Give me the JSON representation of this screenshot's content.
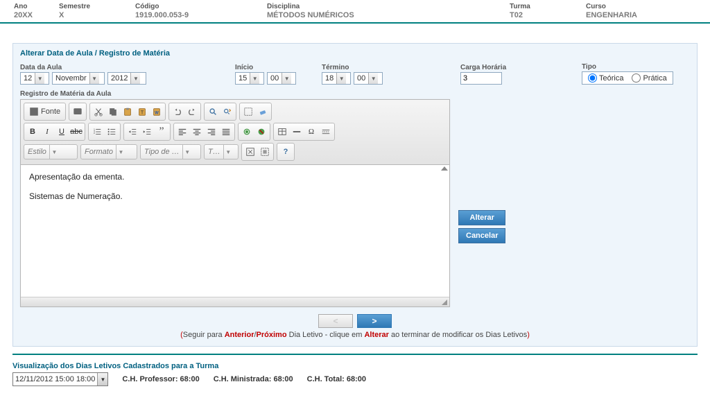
{
  "header": {
    "labels": {
      "ano": "Ano",
      "semestre": "Semestre",
      "codigo": "Código",
      "disciplina": "Disciplina",
      "turma": "Turma",
      "curso": "Curso"
    },
    "values": {
      "ano": "20XX",
      "semestre": "X",
      "codigo": "1919.000.053-9",
      "disciplina": "MÉTODOS NUMÉRICOS",
      "turma": "T02",
      "curso": "ENGENHARIA"
    }
  },
  "panel": {
    "title": "Alterar Data de Aula / Registro de Matéria",
    "data_label": "Data da Aula",
    "date": {
      "day": "12",
      "month": "Novembr",
      "year": "2012"
    },
    "inicio_label": "Início",
    "inicio": {
      "h": "15",
      "m": "00"
    },
    "termino_label": "Término",
    "termino": {
      "h": "18",
      "m": "00"
    },
    "carga_label": "Carga Horária",
    "carga_value": "3",
    "tipo_label": "Tipo",
    "tipo_teorica": "Teórica",
    "tipo_pratica": "Prática",
    "registro_label": "Registro de Matéria da Aula"
  },
  "editor": {
    "source_btn": "Fonte",
    "style_sel": "Estilo",
    "format_sel": "Formato",
    "font_sel": "Tipo de …",
    "size_sel": "T…",
    "content_p1": "Apresentação da ementa.",
    "content_p2": "Sistemas de Numeração."
  },
  "side": {
    "alterar": "Alterar",
    "cancelar": "Cancelar"
  },
  "nav": {
    "prev": "<",
    "next": ">"
  },
  "hint": {
    "open": "(",
    "t1": "Seguir para ",
    "anterior": "Anterior",
    "slash": "/",
    "proximo": "Próximo",
    "t2": " Dia Letivo - clique em ",
    "alterar": "Alterar",
    "t3": " ao terminar de modificar os Dias Letivos",
    "close": ")"
  },
  "bottom": {
    "title": "Visualização dos Dias Letivos Cadastrados para a Turma",
    "select_value": "12/11/2012 15:00 18:00",
    "ch_prof_label": "C.H. Professor: ",
    "ch_prof_value": "68:00",
    "ch_min_label": "C.H. Ministrada: ",
    "ch_min_value": "68:00",
    "ch_total_label": "C.H. Total: ",
    "ch_total_value": "68:00"
  }
}
